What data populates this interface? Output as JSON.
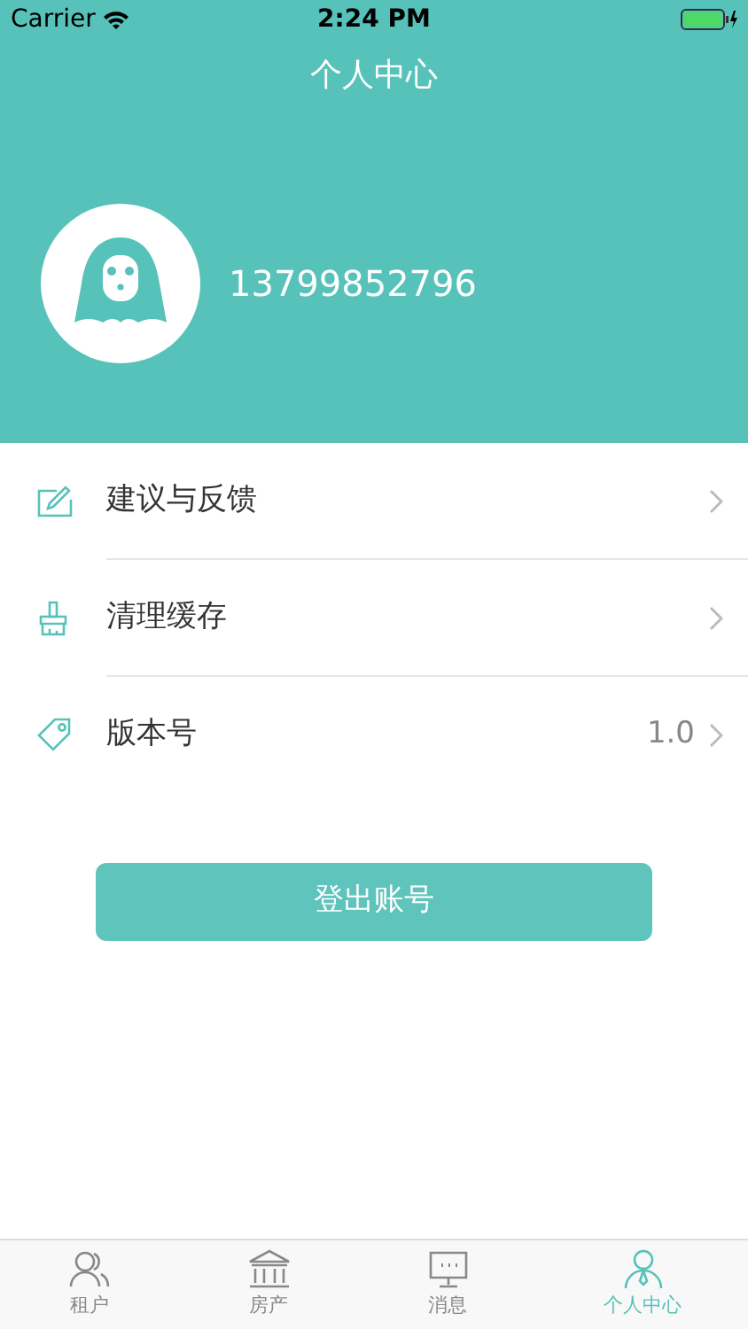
{
  "status_bar": {
    "carrier": "Carrier",
    "time": "2:24 PM"
  },
  "header": {
    "title": "个人中心",
    "phone": "13799852796"
  },
  "menu": [
    {
      "kind": "edit",
      "label": "建议与反馈"
    },
    {
      "kind": "brush",
      "label": "清理缓存"
    },
    {
      "kind": "tag",
      "label": "版本号",
      "value": "1.0"
    }
  ],
  "logout_button": "登出账号",
  "tabs": [
    {
      "kind": "people",
      "label": "租户",
      "selected": false
    },
    {
      "kind": "bank",
      "label": "房产",
      "selected": false
    },
    {
      "kind": "message",
      "label": "消息",
      "selected": false
    },
    {
      "kind": "person",
      "label": "个人中心",
      "selected": true
    }
  ]
}
